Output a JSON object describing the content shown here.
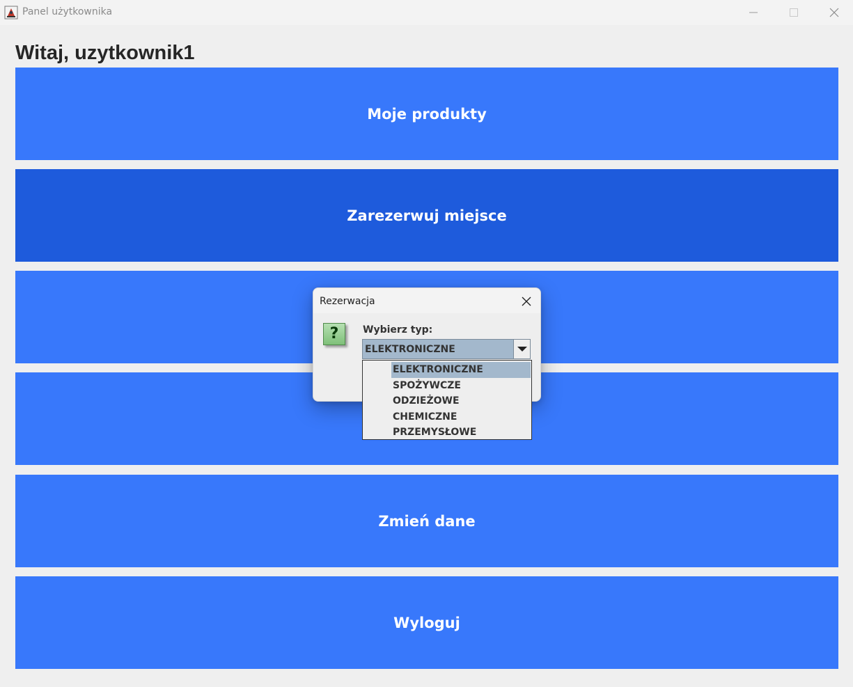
{
  "window": {
    "title": "Panel użytkownika"
  },
  "main": {
    "greeting": "Witaj, uzytkownik1",
    "buttons": [
      {
        "label": "Moje produkty"
      },
      {
        "label": "Zarezerwuj miejsce"
      },
      {
        "label": ""
      },
      {
        "label": ""
      },
      {
        "label": "Zmień dane"
      },
      {
        "label": "Wyloguj"
      }
    ]
  },
  "dialog": {
    "title": "Rezerwacja",
    "prompt": "Wybierz typ:",
    "selected": "ELEKTRONICZNE",
    "options": [
      "ELEKTRONICZNE",
      "SPOŻYWCZE",
      "ODZIEŻOWE",
      "CHEMICZNE",
      "PRZEMYSŁOWE"
    ]
  },
  "colors": {
    "button_blue": "#3878fb",
    "button_hover": "#1e5bdc",
    "selection": "#a3b8cc",
    "background": "#efefef"
  },
  "icons": {
    "app": "java-cup-icon",
    "dialog": "question-icon"
  }
}
